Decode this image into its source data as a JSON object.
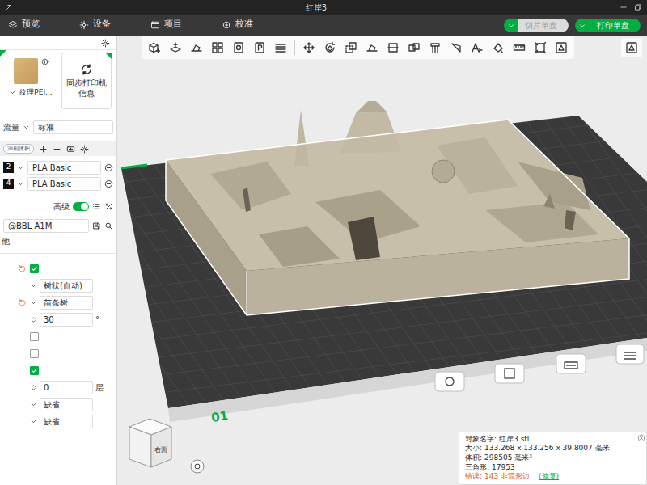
{
  "window": {
    "title": "红岸3"
  },
  "tabs": [
    {
      "label": "预览",
      "selected": false
    },
    {
      "label": "设备",
      "selected": false
    },
    {
      "label": "项目",
      "selected": false
    },
    {
      "label": "校准",
      "selected": false
    }
  ],
  "actions": [
    {
      "label": "切片单盘",
      "disabled": true
    },
    {
      "label": "打印单盘",
      "disabled": false
    }
  ],
  "sidebar": {
    "plate": {
      "label": "纹理PEI..."
    },
    "sync": {
      "label": "同步打印机信息"
    },
    "flow": {
      "label": "流量",
      "value": "标准"
    },
    "filaments": {
      "flush_label": "冲刷体积",
      "items": [
        {
          "index": "2",
          "name": "PLA Basic"
        },
        {
          "index": "4",
          "name": "PLA Basic"
        }
      ]
    },
    "advanced": {
      "label": "高级",
      "on": true
    },
    "printer": {
      "value": "@BBL A1M"
    },
    "section": {
      "label": "他"
    },
    "settings": [
      {
        "kind": "checkbox",
        "modified": true,
        "checked": true
      },
      {
        "kind": "select",
        "modified": false,
        "value": "树状(自动)"
      },
      {
        "kind": "select",
        "modified": true,
        "value": "苗条树"
      },
      {
        "kind": "number",
        "modified": false,
        "value": "30",
        "unit": "°"
      },
      {
        "kind": "checkbox",
        "modified": false,
        "checked": false
      },
      {
        "kind": "checkbox",
        "modified": false,
        "checked": false
      },
      {
        "kind": "checkbox",
        "modified": false,
        "checked": true
      },
      {
        "kind": "number",
        "modified": false,
        "value": "0",
        "unit": "层"
      },
      {
        "kind": "select",
        "modified": false,
        "value": "缺省"
      },
      {
        "kind": "select",
        "modified": false,
        "value": "缺省"
      }
    ]
  },
  "viewport": {
    "plate_label": "01",
    "view_cube": {
      "face": "右面"
    },
    "object_info": {
      "rows": [
        {
          "label": "对象名字:",
          "value": "红岸3.stl"
        },
        {
          "label": "大小:",
          "value": "133.268 x 133.256 x 39.8007 毫米"
        },
        {
          "label": "体积:",
          "value": "298505 毫米³"
        },
        {
          "label": "三角形:",
          "value": "17953"
        }
      ],
      "error": {
        "label": "错误:",
        "value": "143 非流形边",
        "action": "(修复)"
      }
    }
  }
}
